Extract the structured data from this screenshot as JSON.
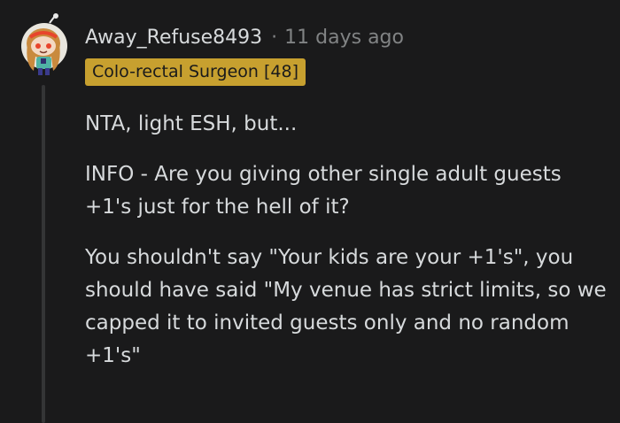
{
  "comment": {
    "author": "Away_Refuse8493",
    "separator": "·",
    "time_ago": "11 days ago",
    "flair": "Colo-rectal Surgeon [48]",
    "paragraphs": [
      "NTA, light ESH, but...",
      "INFO - Are you giving other single adult guests +1's just for the hell of it?",
      "You shouldn't say \"Your kids are your +1's\", you should have said \"My venue has strict limits, so we capped it to invited guests only and no random +1's\""
    ]
  },
  "colors": {
    "background": "#1a1a1b",
    "text": "#d7dadc",
    "muted": "#818384",
    "flair_background": "#c7a02f",
    "thread_line": "#343536"
  },
  "icons": {
    "avatar": "snoo-avatar-icon"
  }
}
